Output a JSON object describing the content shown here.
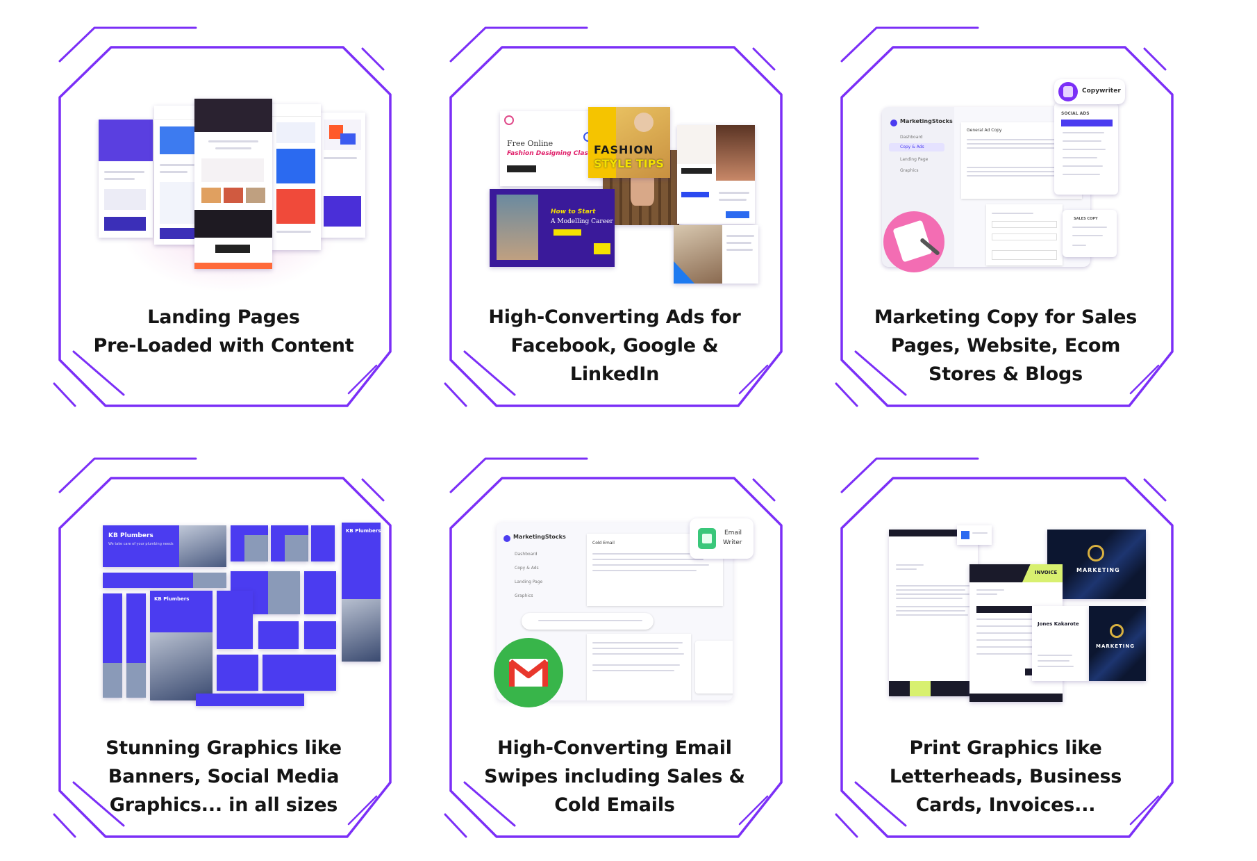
{
  "colors": {
    "frame": "#7b2ff7",
    "text": "#141414",
    "accent_blue": "#4b3cf0",
    "gmail_green": "#38b54a",
    "pink": "#f06ab0"
  },
  "cards": [
    {
      "id": "landing-pages",
      "lines": [
        "Landing Pages",
        "Pre-Loaded with Content"
      ]
    },
    {
      "id": "ads",
      "lines": [
        "High-Converting Ads for",
        "Facebook, Google &",
        "LinkedIn"
      ],
      "visual": {
        "free_online": "Free Online",
        "fashion_class": "Fashion Designing Class",
        "fashion": "FASHION",
        "style_tips": "STYLE TIPS",
        "modelling": "A Modelling Career",
        "how_to": "How to Start"
      }
    },
    {
      "id": "marketing-copy",
      "lines": [
        "Marketing Copy for Sales",
        "Pages, Website, Ecom",
        "Stores & Blogs"
      ],
      "visual": {
        "brand": "MarketingStocks",
        "badge": "Copywriter",
        "menu": [
          "Dashboard",
          "Copy & Ads",
          "Landing Page",
          "Graphics"
        ],
        "doc_title": "General Ad Copy",
        "social_ads": "SOCIAL ADS",
        "sales_copy": "SALES COPY"
      }
    },
    {
      "id": "graphics",
      "lines": [
        "Stunning Graphics like",
        "Banners, Social Media",
        "Graphics... in all sizes"
      ],
      "visual": {
        "brand": "KB Plumbers",
        "tagline": "We take care of your plumbing needs"
      }
    },
    {
      "id": "email",
      "lines": [
        "High-Converting Email",
        "Swipes including Sales &",
        "Cold Emails"
      ],
      "visual": {
        "brand": "MarketingStocks",
        "badge_line1": "Email",
        "badge_line2": "Writer",
        "menu": [
          "Dashboard",
          "Copy & Ads",
          "Landing Page",
          "Graphics"
        ],
        "doc_title": "Cold Email"
      }
    },
    {
      "id": "print",
      "lines": [
        "Print Graphics like",
        "Letterheads, Business",
        "Cards, Invoices..."
      ],
      "visual": {
        "invoice": "INVOICE",
        "marketing": "MARKETING",
        "card_name": "Jones Kakarote"
      }
    }
  ]
}
